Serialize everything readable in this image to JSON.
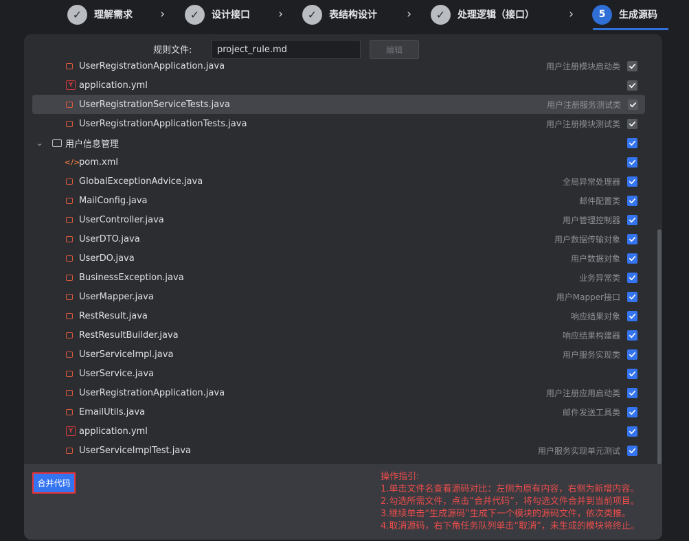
{
  "steps": [
    {
      "label": "理解需求",
      "icon": "check-icon"
    },
    {
      "label": "设计接口",
      "icon": "check-icon"
    },
    {
      "label": "表结构设计",
      "icon": "check-icon"
    },
    {
      "label": "处理逻辑（接口）",
      "icon": "check-icon"
    },
    {
      "label": "生成源码",
      "number": "5"
    }
  ],
  "rule": {
    "label": "规则文件:",
    "value": "project_rule.md",
    "edit_label": "编辑"
  },
  "tree": {
    "rows": [
      {
        "name": "UserRegistrationApplication.java",
        "type": "java",
        "desc": "用户注册模块启动类",
        "checked": "dim"
      },
      {
        "name": "application.yml",
        "type": "yml",
        "desc": "",
        "checked": "dim"
      },
      {
        "name": "UserRegistrationServiceTests.java",
        "type": "java",
        "desc": "用户注册服务测试类",
        "checked": "dim",
        "selected": true
      },
      {
        "name": "UserRegistrationApplicationTests.java",
        "type": "java",
        "desc": "用户注册模块测试类",
        "checked": "dim"
      },
      {
        "name": "用户信息管理",
        "type": "folder",
        "desc": "",
        "checked": "on"
      },
      {
        "name": "pom.xml",
        "type": "xml",
        "desc": "",
        "checked": "on"
      },
      {
        "name": "GlobalExceptionAdvice.java",
        "type": "java",
        "desc": "全局异常处理器",
        "checked": "on"
      },
      {
        "name": "MailConfig.java",
        "type": "java",
        "desc": "邮件配置类",
        "checked": "on"
      },
      {
        "name": "UserController.java",
        "type": "java",
        "desc": "用户管理控制器",
        "checked": "on"
      },
      {
        "name": "UserDTO.java",
        "type": "java",
        "desc": "用户数据传输对象",
        "checked": "on"
      },
      {
        "name": "UserDO.java",
        "type": "java",
        "desc": "用户数据对象",
        "checked": "on"
      },
      {
        "name": "BusinessException.java",
        "type": "java",
        "desc": "业务异常类",
        "checked": "on"
      },
      {
        "name": "UserMapper.java",
        "type": "java",
        "desc": "用户Mapper接口",
        "checked": "on"
      },
      {
        "name": "RestResult.java",
        "type": "java",
        "desc": "响应结果对象",
        "checked": "on"
      },
      {
        "name": "RestResultBuilder.java",
        "type": "java",
        "desc": "响应结果构建器",
        "checked": "on"
      },
      {
        "name": "UserServiceImpl.java",
        "type": "java",
        "desc": "用户服务实现类",
        "checked": "on"
      },
      {
        "name": "UserService.java",
        "type": "java",
        "desc": "",
        "checked": "on"
      },
      {
        "name": "UserRegistrationApplication.java",
        "type": "java",
        "desc": "用户注册应用启动类",
        "checked": "on"
      },
      {
        "name": "EmailUtils.java",
        "type": "java",
        "desc": "邮件发送工具类",
        "checked": "on"
      },
      {
        "name": "application.yml",
        "type": "yml",
        "desc": "",
        "checked": "on"
      },
      {
        "name": "UserServiceImplTest.java",
        "type": "java",
        "desc": "用户服务实现单元测试",
        "checked": "on"
      }
    ]
  },
  "merge_label": "合并代码",
  "guide": {
    "title": "操作指引:",
    "lines": [
      "1.单击文件名查看源码对比：左侧为原有内容，右侧为新增内容。",
      "2.勾选所需文件，点击“合并代码”，将勾选文件合并到当前项目。",
      "3.继续单击“生成源码”生成下一个模块的源码文件，依次类推。",
      "4.取消源码，右下角任务队列单击“取消”，未生成的模块将终止。"
    ]
  }
}
